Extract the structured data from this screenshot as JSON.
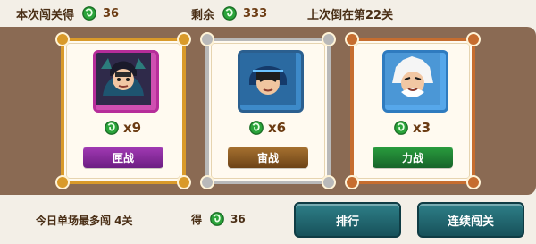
{
  "top_stats": {
    "pass_label": "本次闯关得",
    "pass_value": "36",
    "remain_label": "剩余",
    "remain_value": "333",
    "last_defeat": "上次倒在第22关"
  },
  "cards": [
    {
      "reward": "x9",
      "button_label": "匣战",
      "button_color": "#7a1f86"
    },
    {
      "reward": "x6",
      "button_label": "宙战",
      "button_color": "#8a5a1d"
    },
    {
      "reward": "x3",
      "button_label": "力战",
      "button_color": "#1f7b2f"
    }
  ],
  "bottom": {
    "daily_text": "今日单场最多闯 4关",
    "earn_label": "得",
    "earn_value": "36",
    "rank_button": "排行",
    "continue_button": "连续闯关"
  },
  "colors": {
    "board": "#8a6a53",
    "gold_frame": "#d99a2a",
    "silver_frame": "#b9b9b9",
    "bronze_frame": "#c66d2f",
    "coin_green": "#2aa43a",
    "teal_button": "#1e6770"
  },
  "icons": {
    "coin": "green-coin-icon"
  }
}
